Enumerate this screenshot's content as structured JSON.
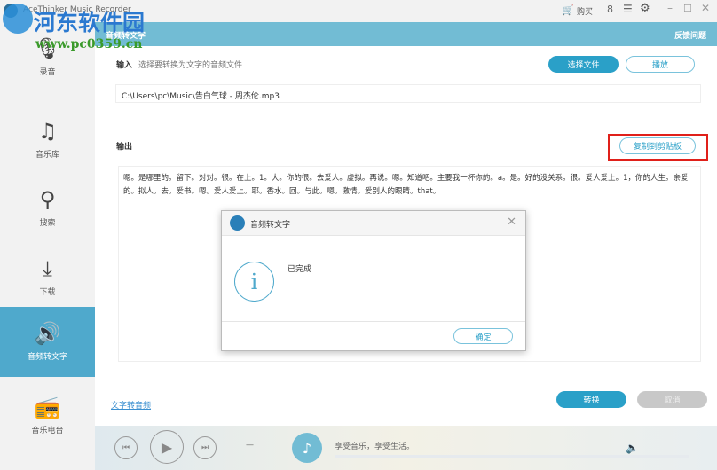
{
  "app": {
    "title": "AceThinker Music Recorder",
    "buy": "购买",
    "watermark": {
      "name": "河东软件园",
      "url": "www.pc0359.cn"
    }
  },
  "sidebar": {
    "items": [
      {
        "label": "录音",
        "icon": "microphone-icon"
      },
      {
        "label": "音乐库",
        "icon": "music-library-icon"
      },
      {
        "label": "搜索",
        "icon": "search-icon"
      },
      {
        "label": "下载",
        "icon": "download-icon"
      },
      {
        "label": "音频转文字",
        "icon": "audio-to-text-icon",
        "active": true
      },
      {
        "label": "音乐电台",
        "icon": "radio-icon"
      }
    ]
  },
  "header": {
    "title": "音频转文字",
    "feedback": "反馈问题"
  },
  "input": {
    "label": "输入",
    "hint": "选择要转换为文字的音频文件",
    "choose_file": "选择文件",
    "play": "播放",
    "path": "C:\\Users\\pc\\Music\\告白气球 - 周杰伦.mp3"
  },
  "output": {
    "label": "输出",
    "copy": "复制到剪贴板",
    "text": "嗯。是哪里的。留下。对对。很。在上。1。大。你的很。去爱人。虚拟。再说。嗯。知道吧。主要我一杯你的。a。是。好的没关系。很。爱人爱上。1，你的人生。亲爱的。拟人。去。爱书。嗯。爱人爱上。耶。香水。回。与此。嗯。激情。爱别人的眼睛。that。"
  },
  "dialog": {
    "title": "音频转文字",
    "message": "已完成",
    "ok": "确定"
  },
  "footer": {
    "text_to_audio": "文字转音频",
    "convert": "转换",
    "cancel": "取消"
  },
  "player": {
    "slogan": "享受音乐，享受生活。",
    "time": "—"
  },
  "colors": {
    "accent": "#2aa0c8",
    "header": "#72bcd4",
    "highlight": "#e0201a"
  }
}
